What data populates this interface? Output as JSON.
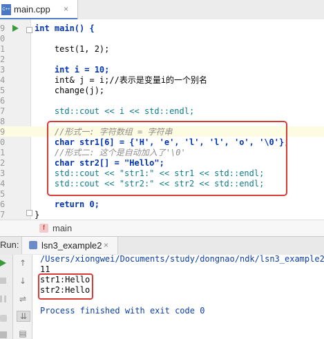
{
  "tab": {
    "label": "main.cpp",
    "file_icon_text": "C++",
    "close": "×"
  },
  "line_numbers": [
    "9",
    "0",
    "1",
    "2",
    "3",
    "4",
    "5",
    "6",
    "7",
    "8",
    "9",
    "0",
    "1",
    "2",
    "3",
    "4",
    "5",
    "6",
    "7"
  ],
  "code_lines": [
    "int main() {",
    "",
    "    test(1, 2);",
    "",
    "    int i = 10;",
    "    int& j = i;//表示是变量i的一个别名",
    "    change(j);",
    "",
    "    std::cout << i << std::endl;",
    "",
    "    //形式一: 字符数组 = 字符串",
    "    char str1[6] = {'H', 'e', 'l', 'l', 'o', '\\0'};",
    "    //形式二: 这个是自动加入了'\\0'",
    "    char str2[] = \"Hello\";",
    "    std::cout << \"str1:\" << str1 << std::endl;",
    "    std::cout << \"str2:\" << str2 << std::endl;",
    "",
    "    return 0;",
    "}"
  ],
  "breadcrumb": {
    "badge": "f",
    "label": "main"
  },
  "run_panel": {
    "title": "Run:",
    "tab_label": "lsn3_example2",
    "close": "×"
  },
  "console_lines": [
    "/Users/xiongwei/Documents/study/dongnao/ndk/lsn3_example2/c",
    "11",
    "str1:Hello",
    "str2:Hello",
    "",
    "Process finished with exit code 0"
  ],
  "colors": {
    "accent": "#4a7cc8",
    "highlight_box": "#d93a33",
    "run_green": "#3a9a3a",
    "console_blue": "#0b3ea8"
  },
  "icons": [
    "cpp-file-icon",
    "run-arrow-icon",
    "function-icon",
    "rerun-icon",
    "up-arrow-icon",
    "down-arrow-icon",
    "stop-icon",
    "pause-icon",
    "wrap-icon",
    "scroll-to-end-icon",
    "print-icon"
  ]
}
